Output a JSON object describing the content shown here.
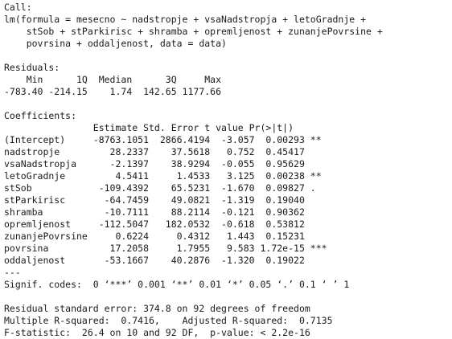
{
  "output": {
    "call_header": "Call:",
    "call_lines": [
      "lm(formula = mesecno ~ nadstropje + vsaNadstropja + letoGradnje +",
      "    stSob + stParkirisc + shramba + opremljenost + zunanjePovrsine +",
      "    povrsina + oddaljenost, data = data)"
    ],
    "residuals_header": "Residuals:",
    "residuals_labels": "    Min      1Q  Median      3Q     Max ",
    "residuals_values": "-783.40 -214.15    1.74  142.65 1177.66 ",
    "coefficients_header": "Coefficients:",
    "coef_table_header": "                Estimate Std. Error t value Pr(>|t|)    ",
    "coef_rows": [
      "(Intercept)     -8763.1051  2866.4194  -3.057  0.00293 ** ",
      "nadstropje         28.2337    37.5618   0.752  0.45417    ",
      "vsaNadstropja      -2.1397    38.9294  -0.055  0.95629    ",
      "letoGradnje         4.5411     1.4533   3.125  0.00238 ** ",
      "stSob            -109.4392    65.5231  -1.670  0.09827 .  ",
      "stParkirisc       -64.7459    49.0821  -1.319  0.19040    ",
      "shramba           -10.7111    88.2114  -0.121  0.90362    ",
      "opremljenost     -112.5047   182.0532  -0.618  0.53812    ",
      "zunanjePovrsine     0.6224     0.4312   1.443  0.15231    ",
      "povrsina           17.2058     1.7955   9.583 1.72e-15 ***",
      "oddaljenost       -53.1667    40.2876  -1.320  0.19022    "
    ],
    "separator": "---",
    "signif_codes": "Signif. codes:  0 ‘***’ 0.001 ‘**’ 0.01 ‘*’ 0.05 ‘.’ 0.1 ‘ ’ 1",
    "residual_se": "Residual standard error: 374.8 on 92 degrees of freedom",
    "r_squared": "Multiple R-squared:  0.7416,\tAdjusted R-squared:  0.7135 ",
    "f_statistic": "F-statistic:  26.4 on 10 and 92 DF,  p-value: < 2.2e-16"
  }
}
